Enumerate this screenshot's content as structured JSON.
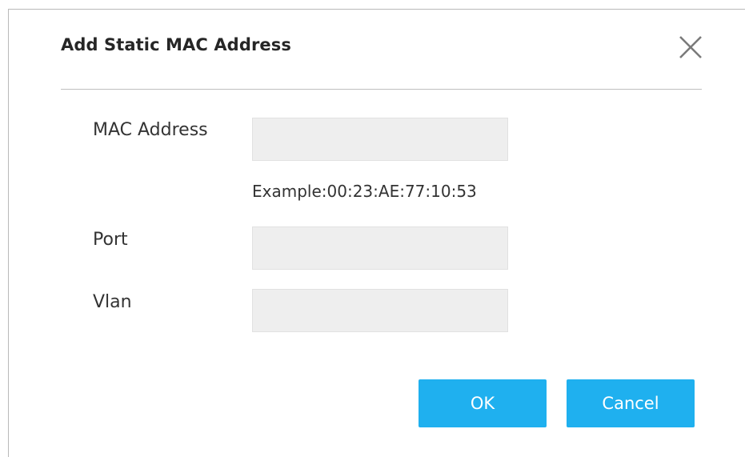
{
  "dialog": {
    "title": "Add Static MAC Address",
    "close_icon": "close-icon"
  },
  "form": {
    "mac_address": {
      "label": "MAC Address",
      "value": "",
      "placeholder": "",
      "hint": "Example:00:23:AE:77:10:53"
    },
    "port": {
      "label": "Port",
      "value": "",
      "placeholder": ""
    },
    "vlan": {
      "label": "Vlan",
      "value": "",
      "placeholder": ""
    }
  },
  "buttons": {
    "ok_label": "OK",
    "cancel_label": "Cancel"
  },
  "colors": {
    "button_bg": "#1fb0ef",
    "field_bg": "#eeeeee",
    "divider": "#bfbfbf"
  }
}
